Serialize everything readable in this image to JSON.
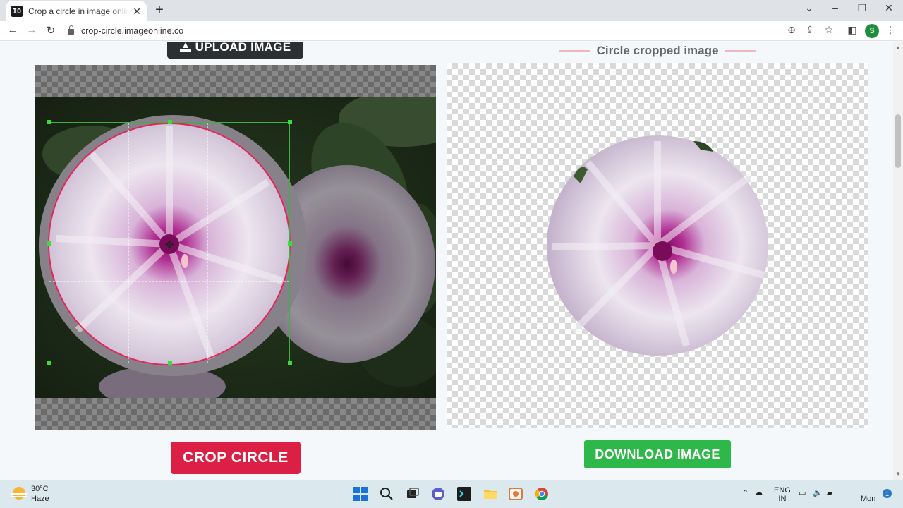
{
  "browser": {
    "tab_title": "Crop a circle in image online - free",
    "favicon_text": "IO",
    "close_tab": "✕",
    "new_tab": "+",
    "url": "crop-circle.imageonline.co",
    "profile_initial": "S",
    "window_controls": [
      "⌄",
      "–",
      "❐",
      "✕"
    ]
  },
  "page": {
    "upload_label": "UPLOAD IMAGE",
    "result_title": "Circle cropped image",
    "crop_button": "CROP CIRCLE",
    "download_button": "DOWNLOAD IMAGE"
  },
  "colors": {
    "crop_button": "#dc1f44",
    "download_button": "#2fb84a",
    "upload_button": "#2d3033",
    "crop_circle_stroke": "#e5245a",
    "crop_box_stroke": "#3cb043"
  },
  "taskbar": {
    "temperature": "30°C",
    "condition": "Haze",
    "language": "ENG",
    "region": "IN",
    "clock": "Mon",
    "notifications": "1"
  }
}
